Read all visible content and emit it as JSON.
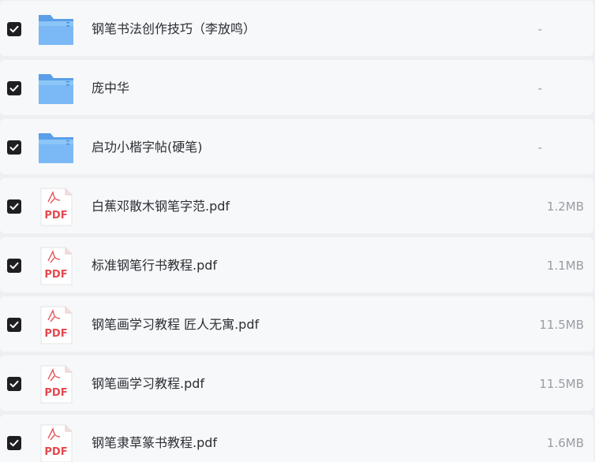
{
  "files": [
    {
      "name": "钢笔书法创作技巧（李放鸣）",
      "size": "-",
      "type": "folder",
      "checked": true
    },
    {
      "name": "庞中华",
      "size": "-",
      "type": "folder",
      "checked": true
    },
    {
      "name": "启功小楷字帖(硬笔)",
      "size": "-",
      "type": "folder",
      "checked": true
    },
    {
      "name": "白蕉邓散木钢笔字范.pdf",
      "size": "1.2MB",
      "type": "pdf",
      "checked": true
    },
    {
      "name": "标准钢笔行书教程.pdf",
      "size": "1.1MB",
      "type": "pdf",
      "checked": true
    },
    {
      "name": "钢笔画学习教程 匠人无寓.pdf",
      "size": "11.5MB",
      "type": "pdf",
      "checked": true
    },
    {
      "name": "钢笔画学习教程.pdf",
      "size": "11.5MB",
      "type": "pdf",
      "checked": true
    },
    {
      "name": "钢笔隶草篆书教程.pdf",
      "size": "1.6MB",
      "type": "pdf",
      "checked": true
    }
  ],
  "pdf_icon_label": "PDF",
  "colors": {
    "folder": "#5fa8f0",
    "pdf_red": "#e5484d",
    "checkbox": "#1f1f23"
  }
}
